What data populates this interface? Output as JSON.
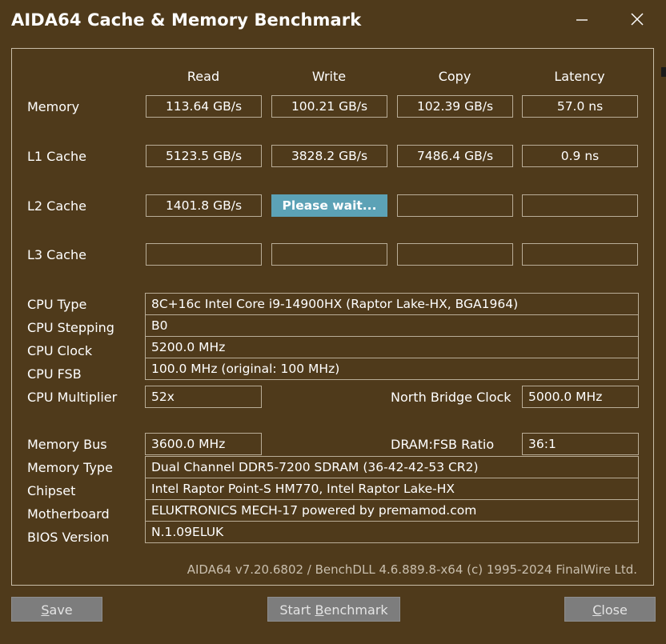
{
  "window": {
    "title": "AIDA64 Cache & Memory Benchmark"
  },
  "titlebar_icons": [
    "minimize-icon",
    "close-icon"
  ],
  "columns": [
    "Read",
    "Write",
    "Copy",
    "Latency"
  ],
  "bench": {
    "memory": {
      "label": "Memory",
      "read": "113.64 GB/s",
      "write": "100.21 GB/s",
      "copy": "102.39 GB/s",
      "latency": "57.0 ns"
    },
    "l1": {
      "label": "L1 Cache",
      "read": "5123.5 GB/s",
      "write": "3828.2 GB/s",
      "copy": "7486.4 GB/s",
      "latency": "0.9 ns"
    },
    "l2": {
      "label": "L2 Cache",
      "read": "1401.8 GB/s",
      "write": "Please wait...",
      "copy": "",
      "latency": ""
    },
    "l3": {
      "label": "L3 Cache",
      "read": "",
      "write": "",
      "copy": "",
      "latency": ""
    }
  },
  "cpu": {
    "type_label": "CPU Type",
    "type": "8C+16c Intel Core i9-14900HX  (Raptor Lake-HX, BGA1964)",
    "stepping_label": "CPU Stepping",
    "stepping": "B0",
    "clock_label": "CPU Clock",
    "clock": "5200.0 MHz",
    "fsb_label": "CPU FSB",
    "fsb": "100.0 MHz  (original: 100 MHz)",
    "multiplier_label": "CPU Multiplier",
    "multiplier": "52x",
    "nb_clock_label": "North Bridge Clock",
    "nb_clock": "5000.0 MHz"
  },
  "mem": {
    "bus_label": "Memory Bus",
    "bus": "3600.0 MHz",
    "ratio_label": "DRAM:FSB Ratio",
    "ratio": "36:1",
    "type_label": "Memory Type",
    "type": "Dual Channel DDR5-7200 SDRAM  (36-42-42-53 CR2)",
    "chipset_label": "Chipset",
    "chipset": "Intel Raptor Point-S HM770, Intel Raptor Lake-HX",
    "motherboard_label": "Motherboard",
    "motherboard": "ELUKTRONICS MECH-17 powered by premamod.com",
    "bios_label": "BIOS Version",
    "bios": "N.1.09ELUK"
  },
  "footer": "AIDA64 v7.20.6802 / BenchDLL 4.6.889.8-x64  (c) 1995-2024 FinalWire Ltd.",
  "buttons": {
    "save_accel": "S",
    "save_rest": "ave",
    "start_pre": "Start ",
    "start_accel": "B",
    "start_post": "enchmark",
    "close_accel": "C",
    "close_rest": "lose"
  }
}
